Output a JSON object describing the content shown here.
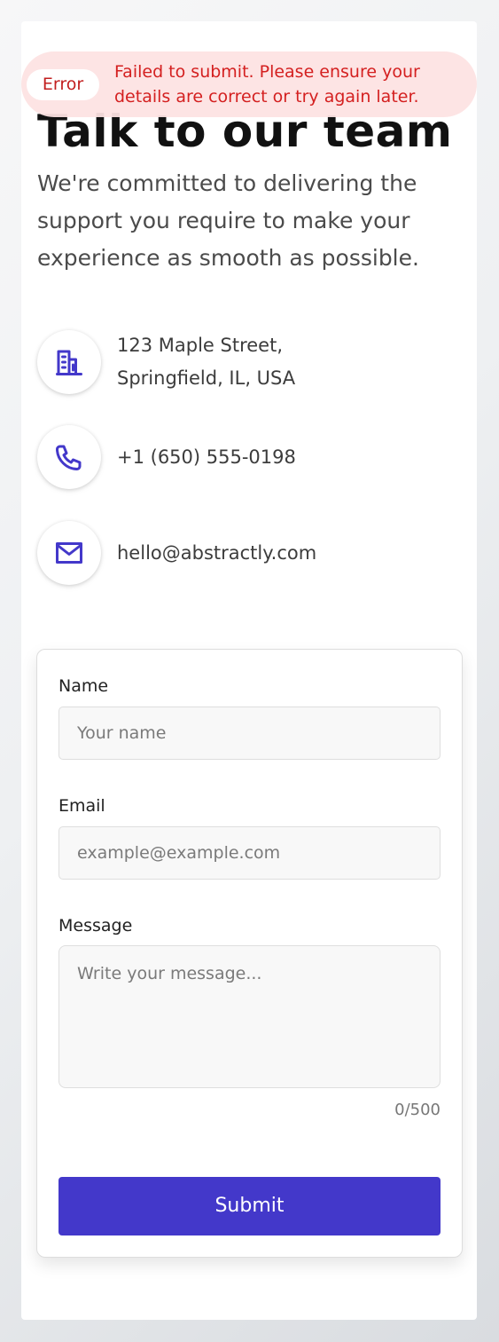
{
  "page": {
    "title": "Talk to our team",
    "intro": "We're committed to delivering the support you require to make your experience as smooth as possible."
  },
  "contacts": [
    {
      "icon": "building-icon",
      "lines": [
        "123 Maple Street,",
        "Springfield, IL, USA"
      ]
    },
    {
      "icon": "phone-icon",
      "lines": [
        "+1 (650) 555-0198"
      ]
    },
    {
      "icon": "mail-icon",
      "lines": [
        "hello@abstractly.com"
      ]
    }
  ],
  "form": {
    "name": {
      "label": "Name",
      "placeholder": "Your name"
    },
    "email": {
      "label": "Email",
      "placeholder": "example@example.com"
    },
    "message": {
      "label": "Message",
      "placeholder": "Write your message...",
      "counter": "0/500"
    },
    "submit_label": "Submit"
  },
  "toast": {
    "badge": "Error",
    "message": "Failed to submit. Please ensure your details are correct or try again later."
  },
  "colors": {
    "accent": "#4338ca",
    "error_text": "#d42020",
    "error_background": "#fde2e2"
  }
}
